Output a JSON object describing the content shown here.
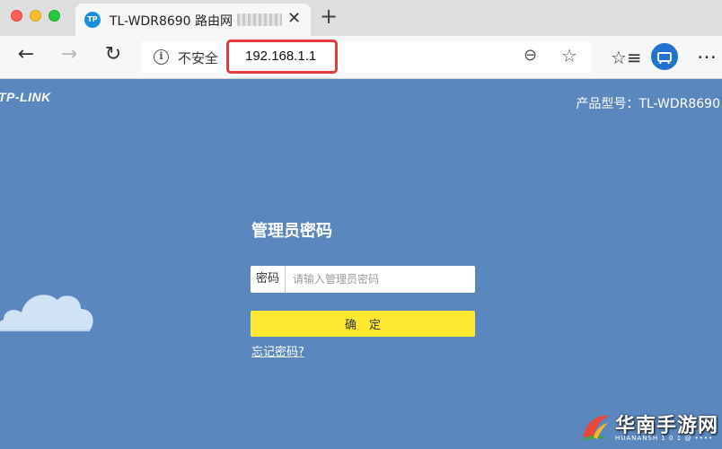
{
  "browser": {
    "tab": {
      "favicon_text": "TP",
      "title": "TL-WDR8690 路由网",
      "close": "✕"
    },
    "new_tab": "+",
    "nav": {
      "back": "←",
      "forward": "→",
      "reload": "↻"
    },
    "address": {
      "security_label": "不安全",
      "url": "192.168.1.1"
    },
    "icons": {
      "zoom": "⊖",
      "favorite": "☆",
      "favorites_list": "☆≡",
      "menu": "…"
    },
    "accent_color": "#1e73d2",
    "highlight_color": "#e33b3b"
  },
  "page": {
    "brand": "TP-LINK",
    "model_label": "产品型号：TL-WDR8690",
    "login": {
      "title": "管理员密码",
      "password_label": "密码",
      "password_placeholder": "请输入管理员密码",
      "confirm_button": "确定",
      "forgot_link": "忘记密码?"
    },
    "background_color": "#5b87bf",
    "button_color": "#fee930"
  },
  "watermark": {
    "title": "华南手游网",
    "subtitle": "HUANANSH 1 0 1 @ ••••"
  }
}
